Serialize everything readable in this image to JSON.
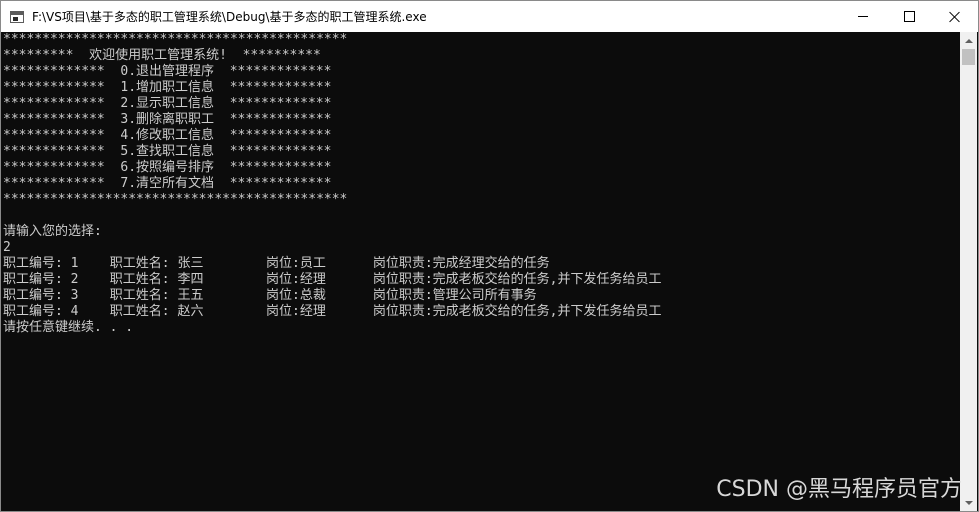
{
  "window": {
    "title": "F:\\VS项目\\基于多态的职工管理系统\\Debug\\基于多态的职工管理系统.exe"
  },
  "icons": {
    "app": "console-app-icon",
    "minimize": "minimize-icon",
    "maximize": "maximize-icon",
    "close": "close-icon"
  },
  "console": {
    "lines": [
      "********************************************",
      "*********  欢迎使用职工管理系统!  **********",
      "*************  0.退出管理程序  *************",
      "*************  1.增加职工信息  *************",
      "*************  2.显示职工信息  *************",
      "*************  3.删除离职职工  *************",
      "*************  4.修改职工信息  *************",
      "*************  5.查找职工信息  *************",
      "*************  6.按照编号排序  *************",
      "*************  7.清空所有文档  *************",
      "********************************************",
      "",
      "请输入您的选择:",
      "2",
      "职工编号: 1    职工姓名: 张三        岗位:员工      岗位职责:完成经理交给的任务",
      "职工编号: 2    职工姓名: 李四        岗位:经理      岗位职责:完成老板交给的任务,并下发任务给员工",
      "职工编号: 3    职工姓名: 王五        岗位:总裁      岗位职责:管理公司所有事务",
      "职工编号: 4    职工姓名: 赵六        岗位:经理      岗位职责:完成老板交给的任务,并下发任务给员工",
      "请按任意键继续. . ."
    ]
  },
  "watermark": "CSDN @黑马程序员官方"
}
